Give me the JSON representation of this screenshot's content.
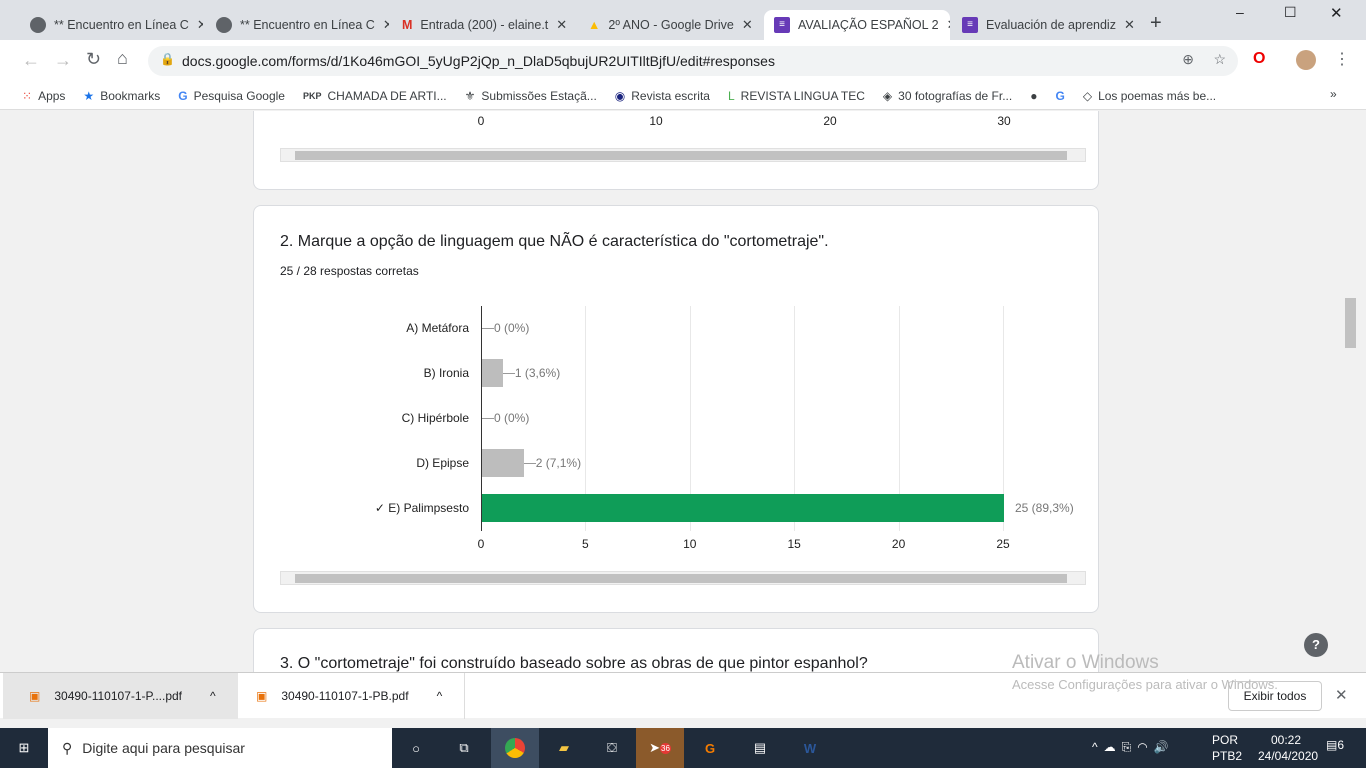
{
  "browser": {
    "tabs": [
      {
        "title": "** Encuentro en Línea C",
        "active": false
      },
      {
        "title": "** Encuentro en Línea C",
        "active": false
      },
      {
        "title": "Entrada (200) - elaine.t",
        "active": false
      },
      {
        "title": "2º ANO - Google Drive",
        "active": false
      },
      {
        "title": "AVALIAÇÃO ESPAÑOL 2",
        "active": true
      },
      {
        "title": "Evaluación de aprendiz",
        "active": false
      }
    ],
    "url": "docs.google.com/forms/d/1Ko46mGOI_5yUgP2jQp_n_DlaD5qbujUR2UITIltBjfU/edit#responses",
    "bookmarks": [
      "Apps",
      "Bookmarks",
      "Pesquisa Google",
      "CHAMADA DE ARTI...",
      "Submissões Estaçã...",
      "Revista escrita",
      "REVISTA LINGUA TEC",
      "30 fotografías de Fr...",
      "",
      "",
      "Los poemas más be..."
    ]
  },
  "prev_chart": {
    "ticks": [
      "0",
      "10",
      "20",
      "30"
    ]
  },
  "question2": {
    "title": "2. Marque a opção de linguagem que NÃO é característica do \"cortometraje\".",
    "score": "25 / 28 respostas corretas"
  },
  "chart_data": {
    "type": "bar",
    "orientation": "horizontal",
    "categories": [
      "A) Metáfora",
      "B) Ironia",
      "C) Hipérbole",
      "D) Epipse",
      "✓ E) Palimpsesto"
    ],
    "values": [
      0,
      1,
      0,
      2,
      25
    ],
    "data_labels": [
      "0 (0%)",
      "1 (3,6%)",
      "0 (0%)",
      "2 (7,1%)",
      "25 (89,3%)"
    ],
    "correct_index": 4,
    "xlim": [
      0,
      25
    ],
    "xticks": [
      "0",
      "5",
      "10",
      "15",
      "20",
      "25"
    ],
    "grid": true,
    "colors": {
      "correct": "#0f9d58",
      "incorrect": "#bdbdbd"
    }
  },
  "question3": {
    "title": "3. O \"cortometraje\" foi construído baseado sobre as obras de que pintor espanhol?"
  },
  "watermark": {
    "title": "Ativar o Windows",
    "subtitle": "Acesse Configurações para ativar o Windows."
  },
  "downloads": {
    "items": [
      "30490-110107-1-P....pdf",
      "30490-110107-1-PB.pdf"
    ],
    "show_all": "Exibir todos"
  },
  "taskbar": {
    "search": "Digite aqui para pesquisar",
    "lang": "POR",
    "layout": "PTB2",
    "time": "00:22",
    "date": "24/04/2020",
    "notifications": "6",
    "badge": "36"
  }
}
